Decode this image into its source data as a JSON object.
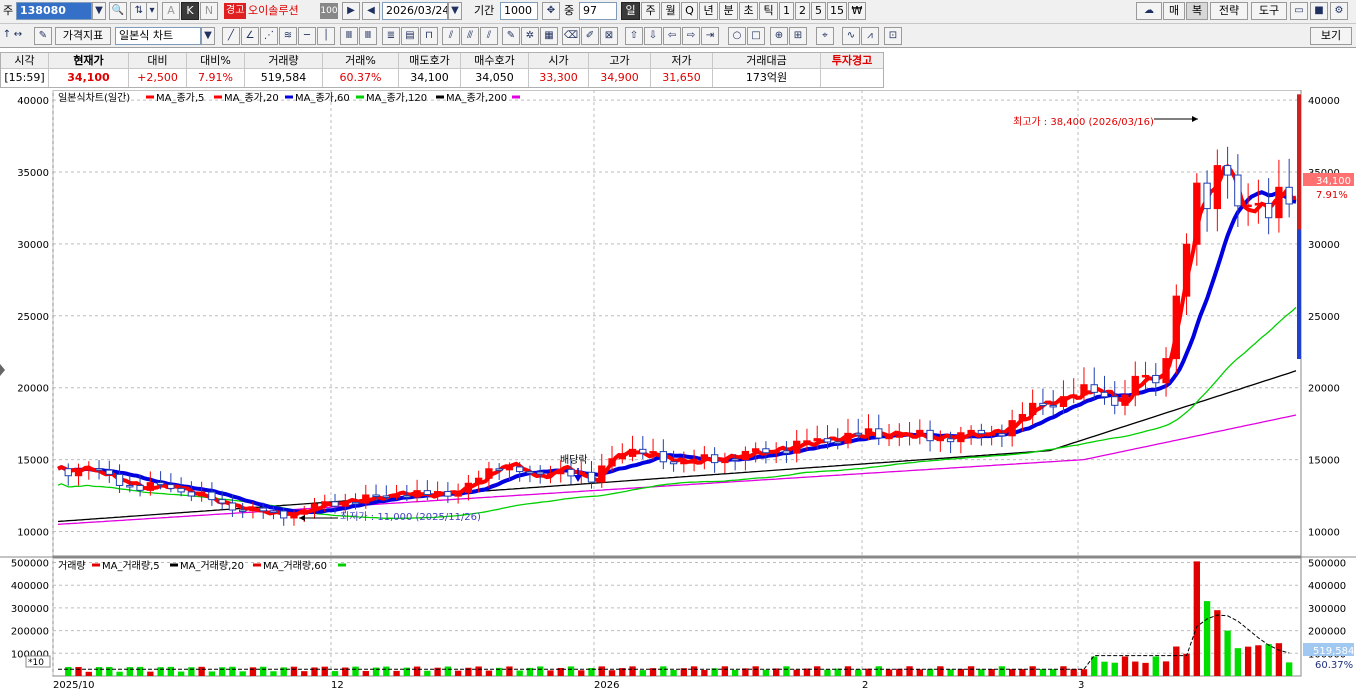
{
  "toolbar1": {
    "stock_prefix": "주",
    "stock_code": "138080",
    "k_label": "K",
    "n_label": "N",
    "a_label": "A",
    "warn_badge": "경고",
    "stock_name": "오이솔루션",
    "margin_badge": "100",
    "date_value": "2026/03/24",
    "period_label": "기간",
    "period_value": "1000",
    "mid_label": "중",
    "mid_value": "97",
    "periods": [
      "일",
      "주",
      "월",
      "Q",
      "년",
      "분",
      "초",
      "틱",
      "1",
      "2",
      "5",
      "15"
    ],
    "won_icon": "₩",
    "right_buttons": [
      "매",
      "복",
      "전략",
      "도구"
    ]
  },
  "toolbar2": {
    "indicator_button": "가격지표",
    "chart_type": "일본식 차트",
    "view_button": "보기"
  },
  "quote": {
    "headers": [
      "시각",
      "현재가",
      "대비",
      "대비%",
      "거래량",
      "거래%",
      "매도호가",
      "매수호가",
      "시가",
      "고가",
      "저가",
      "거래대금",
      "투자경고"
    ],
    "values": [
      "[15:59]",
      "34,100",
      "+2,500",
      "7.91%",
      "519,584",
      "60.37%",
      "34,100",
      "34,050",
      "33,300",
      "34,900",
      "31,650",
      "173억원",
      ""
    ]
  },
  "colors": {
    "up": "#ff0000",
    "down": "#0000ff",
    "ma5": "#ff0000",
    "ma20": "#0000e0",
    "ma60": "#00d000",
    "ma120": "#000000",
    "ma200": "#e000e0",
    "vol_up": "#e00000",
    "vol_down": "#00dd00"
  },
  "legend": {
    "price": [
      "일본식차트(일간)",
      "MA_종가,5",
      "MA_종가,20",
      "MA_종가,60",
      "MA_종가,120",
      "MA_종가,200"
    ],
    "volume": [
      "거래량",
      "MA_거래량,5",
      "MA_거래량,20",
      "MA_거래량,60"
    ]
  },
  "annotations": {
    "high": "최고가 : 38,400 (2026/03/16)",
    "low": "최저가 : 11,000 (2025/11/26)",
    "dividend": "배당락",
    "current_price_tag": "34,100",
    "current_pct_tag": "7.91%",
    "volume_tag": "519,584",
    "volume_pct_tag": "60.37%",
    "volume_unit": "*10"
  },
  "chart_data": {
    "type": "candlestick",
    "price_axis_ticks": [
      10000,
      15000,
      20000,
      25000,
      30000,
      35000,
      40000
    ],
    "price_range": [
      8300,
      40700
    ],
    "volume_axis_ticks": [
      100000,
      200000,
      300000,
      400000,
      500000
    ],
    "volume_range": [
      0,
      520000
    ],
    "x_labels": [
      "2025/10",
      "12",
      "2026",
      "2",
      "3"
    ],
    "high": 38400,
    "low": 11000,
    "last_close": 34100,
    "ma_series_endpoints": {
      "MA_종가,5": 32900,
      "MA_종가,20": 29800,
      "MA_종가,60": 22400,
      "MA_종가,120": 18500,
      "MA_종가,200": 16000
    }
  }
}
